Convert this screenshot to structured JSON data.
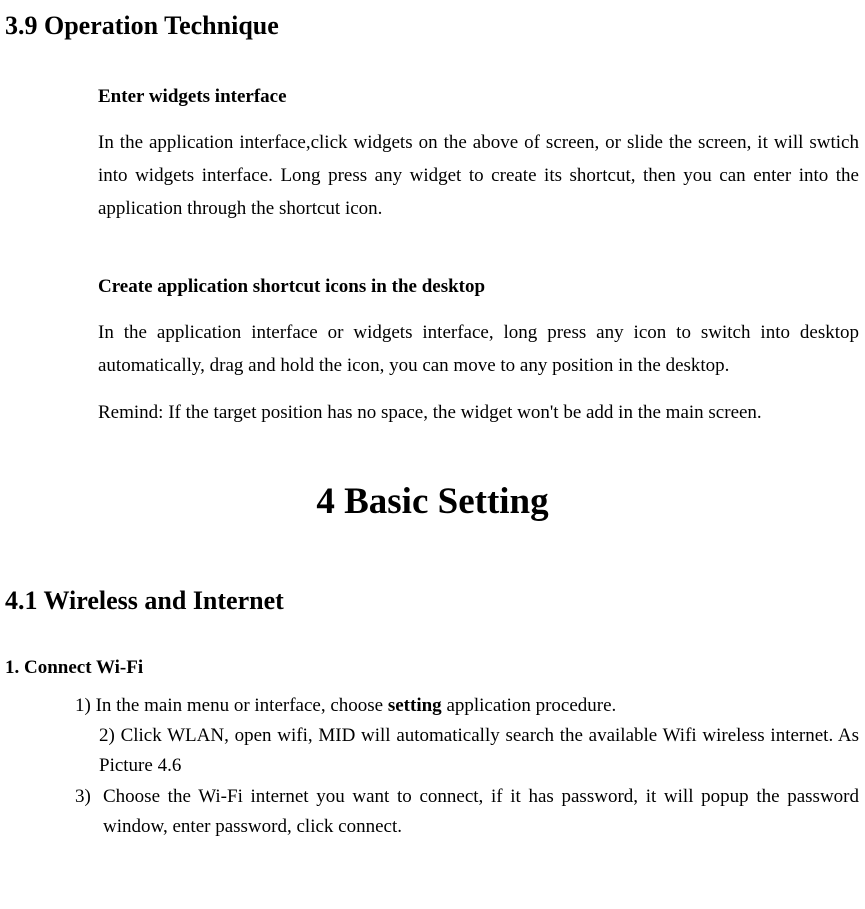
{
  "section39": {
    "heading": "3.9 Operation Technique",
    "sub1_title": "Enter widgets interface",
    "sub1_body": "In the application interface,click widgets on the above of screen, or slide the screen, it will swtich into widgets interface. Long press any widget to create its shortcut, then you can enter into the application through the shortcut icon.",
    "sub2_title": "Create application shortcut icons in the desktop",
    "sub2_body1": "In the application interface or widgets interface, long press any icon to switch into desktop automatically, drag and hold the icon, you can move to any position in the desktop.",
    "sub2_body2": "Remind: If the target position has no space, the widget won't be add in the main screen."
  },
  "chapter4": {
    "title": "4 Basic Setting"
  },
  "section41": {
    "heading": "4.1 Wireless and Internet",
    "connect_title": "1. Connect Wi-Fi",
    "item1_prefix": "1) In the main menu or interface, choose ",
    "item1_bold": "setting",
    "item1_suffix": " application procedure.",
    "item2": "2) Click WLAN, open wifi, MID will automatically search the available Wifi wireless internet. As Picture 4.6",
    "item3_num": "3)",
    "item3_text": "Choose the Wi-Fi internet you want to connect, if it has password, it will popup the password window, enter password, click connect."
  }
}
